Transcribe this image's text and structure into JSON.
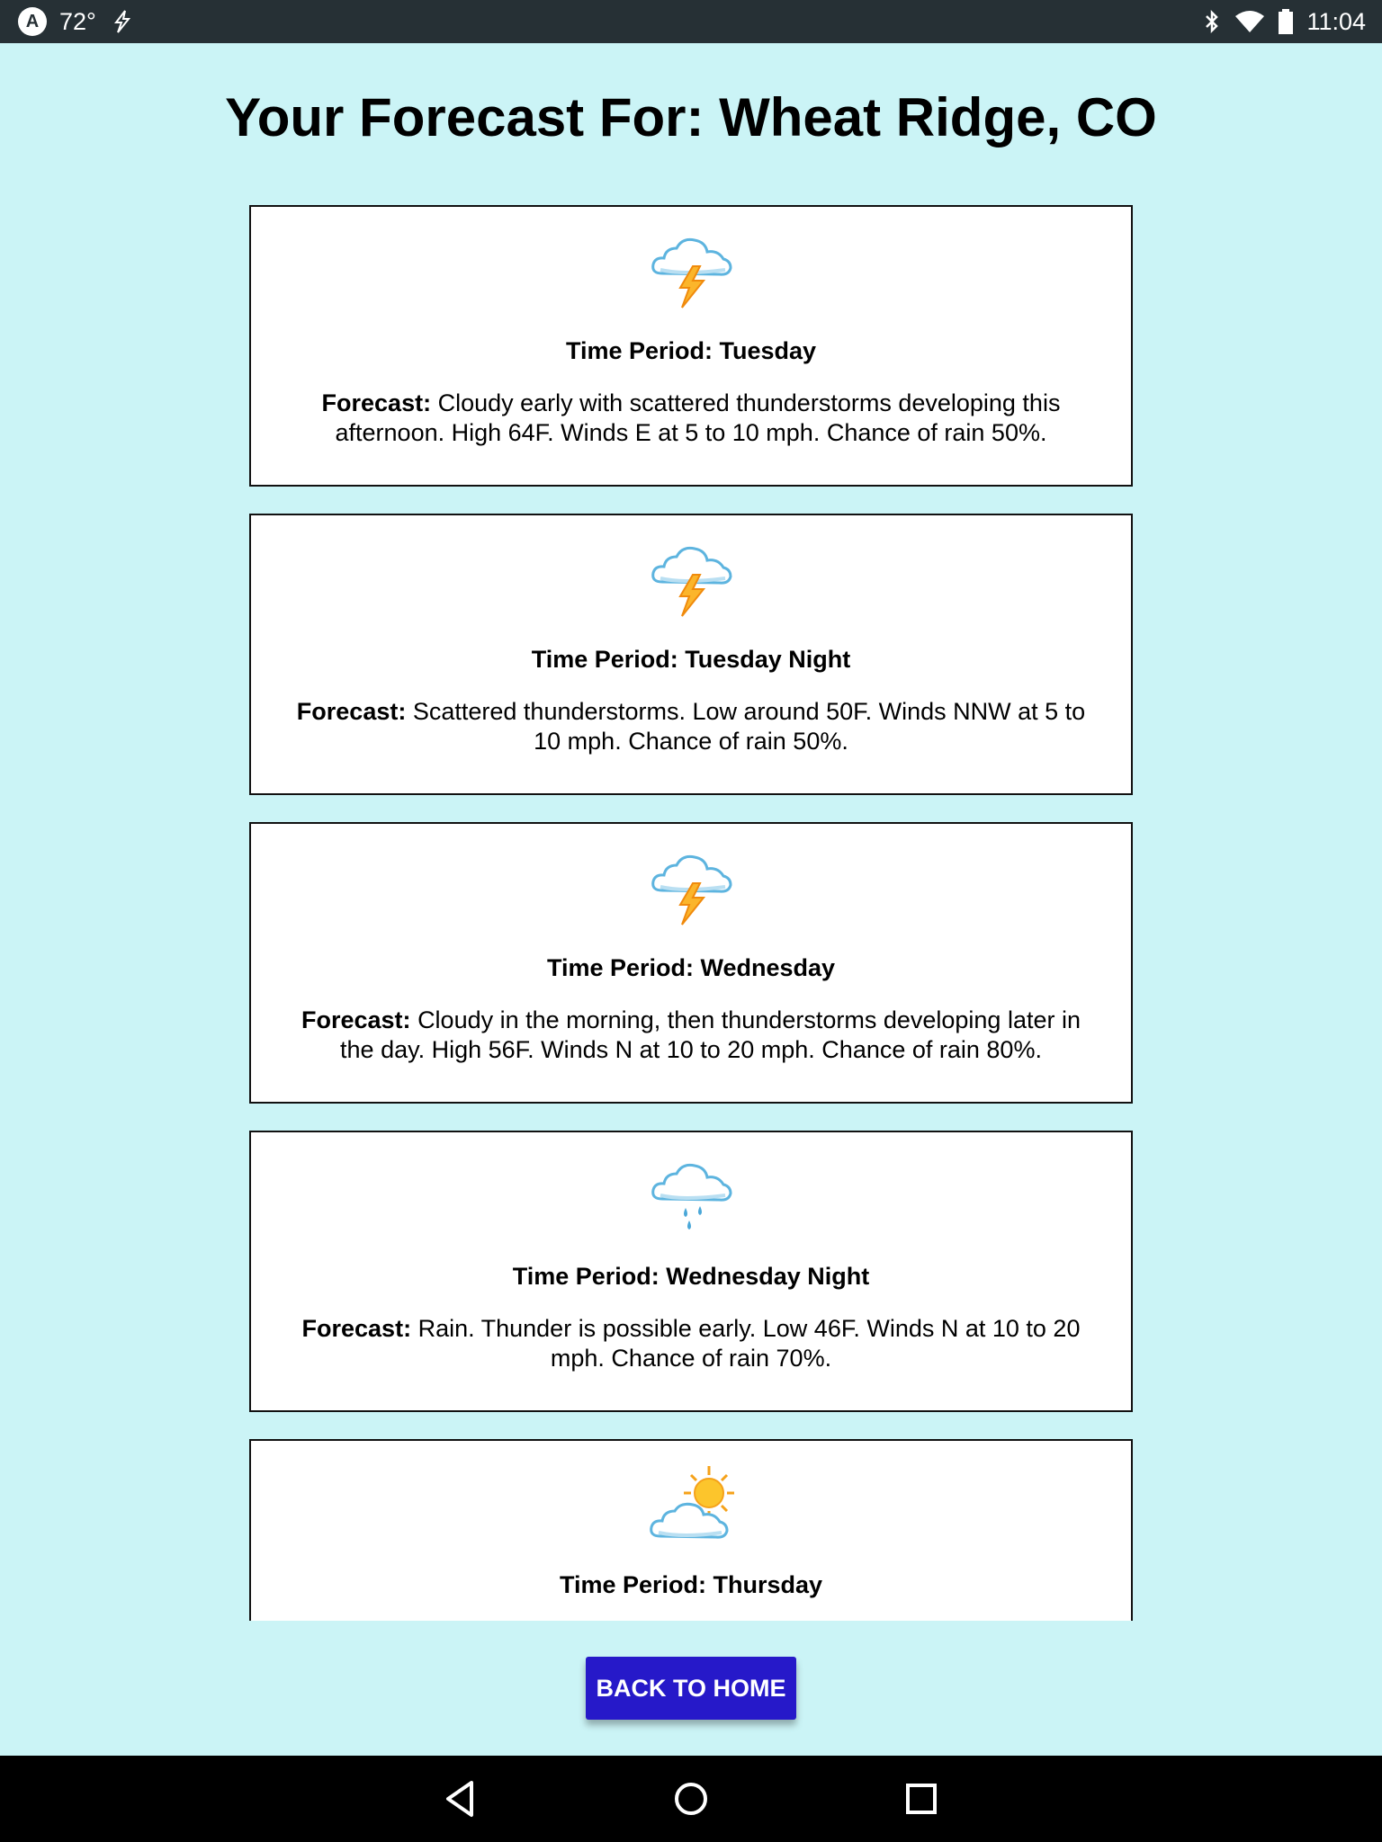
{
  "status_bar": {
    "app_badge": "A",
    "temperature": "72°",
    "time": "11:04"
  },
  "page_title": "Your Forecast For: Wheat Ridge, CO",
  "forecast_label": "Forecast:",
  "cards": [
    {
      "icon": "thunderstorm-icon",
      "period": "Time Period: Tuesday",
      "forecast": "Cloudy early with scattered thunderstorms developing this afternoon. High 64F. Winds E at 5 to 10 mph. Chance of rain 50%."
    },
    {
      "icon": "thunderstorm-icon",
      "period": "Time Period: Tuesday Night",
      "forecast": "Scattered thunderstorms. Low around 50F. Winds NNW at 5 to 10 mph. Chance of rain 50%."
    },
    {
      "icon": "thunderstorm-icon",
      "period": "Time Period: Wednesday",
      "forecast": "Cloudy in the morning, then thunderstorms developing later in the day. High 56F. Winds N at 10 to 20 mph. Chance of rain 80%."
    },
    {
      "icon": "rain-icon",
      "period": "Time Period: Wednesday Night",
      "forecast": "Rain. Thunder is possible early. Low 46F. Winds N at 10 to 20 mph. Chance of rain 70%."
    },
    {
      "icon": "partly-cloudy-icon",
      "period": "Time Period: Thursday",
      "forecast": ""
    }
  ],
  "back_button": "BACK TO HOME",
  "colors": {
    "background": "#cbf4f6",
    "button": "#2619c9",
    "status_bar": "#263035"
  }
}
